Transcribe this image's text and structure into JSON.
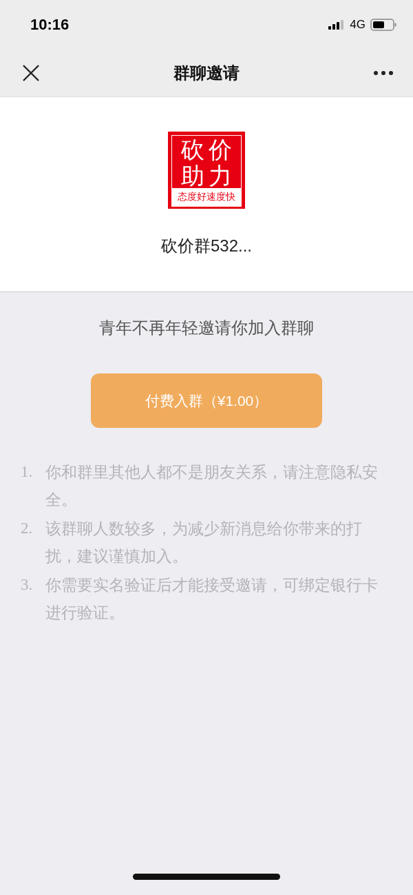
{
  "status_bar": {
    "time": "10:16",
    "network": "4G"
  },
  "nav": {
    "title": "群聊邀请"
  },
  "group": {
    "logo": {
      "lines": [
        "砍价",
        "助力"
      ],
      "tagline": "态度好速度快"
    },
    "name": "砍价群532..."
  },
  "invite": {
    "message": "青年不再年轻邀请你加入群聊",
    "button": "付费入群（¥1.00）"
  },
  "notes": [
    {
      "number": "1.",
      "text": "你和群里其他人都不是朋友关系，请注意隐私安全。"
    },
    {
      "number": "2.",
      "text": "该群聊人数较多，为减少新消息给你带来的打扰，建议谨慎加入。"
    },
    {
      "number": "3.",
      "text": "你需要实名验证后才能接受邀请，可绑定银行卡进行验证。"
    }
  ]
}
